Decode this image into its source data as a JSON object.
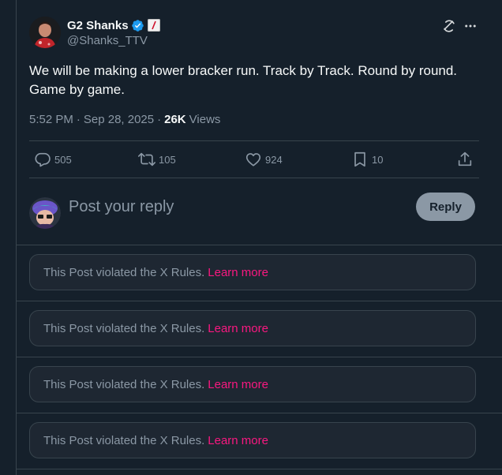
{
  "author": {
    "display_name": "G2 Shanks",
    "handle": "@Shanks_TTV",
    "verified": true,
    "accent_color": "#1d9bf0"
  },
  "post": {
    "text": "We will be making a lower bracker run. Track by Track. Round by round. Game by game.",
    "time": "5:52 PM",
    "dot": "·",
    "date": "Sep 28, 2025",
    "views_count": "26K",
    "views_label": "Views"
  },
  "actions": {
    "replies": "505",
    "reposts": "105",
    "likes": "924",
    "bookmarks": "10"
  },
  "composer": {
    "placeholder": "Post your reply",
    "button_label": "Reply"
  },
  "violated_replies": [
    {
      "message": "This Post violated the X Rules.",
      "link": "Learn more"
    },
    {
      "message": "This Post violated the X Rules.",
      "link": "Learn more"
    },
    {
      "message": "This Post violated the X Rules.",
      "link": "Learn more"
    },
    {
      "message": "This Post violated the X Rules.",
      "link": "Learn more"
    }
  ],
  "colors": {
    "background": "#15202b",
    "border": "#38444d",
    "muted_text": "#8b98a5",
    "link": "#f91880"
  }
}
